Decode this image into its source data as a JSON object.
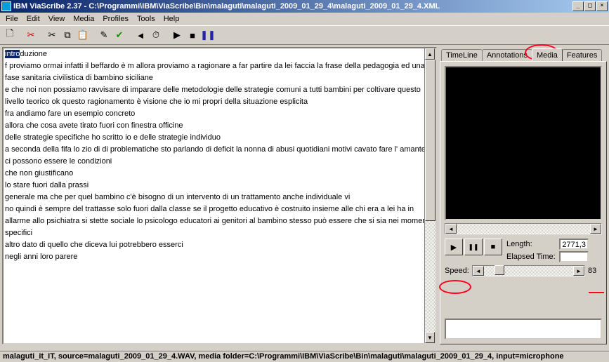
{
  "window": {
    "title": "IBM ViaScribe 2.37 - C:\\Programmi\\IBM\\ViaScribe\\Bin\\malaguti\\malaguti_2009_01_29_4\\malaguti_2009_01_29_4.XML",
    "min": "_",
    "max": "□",
    "close": "×"
  },
  "menu": {
    "file": "File",
    "edit": "Edit",
    "view": "View",
    "media": "Media",
    "profiles": "Profiles",
    "tools": "Tools",
    "help": "Help"
  },
  "transcript": {
    "highlight": "intro",
    "rest_first": "duzione",
    "body": "f proviamo ormai infatti il beffardo è m allora proviamo a ragionare a far partire da lei faccia la frase della pedagogia ed una fase sanitaria civilistica di bambino siciliane\ne che noi non possiamo ravvisare di imparare delle metodologie delle strategie comuni a tutti bambini per coltivare questo livello teorico ok questo ragionamento è visione che io mi propri della situazione esplicita\nfra andiamo fare un esempio concreto\nallora che cosa avete tirato fuori con finestra officine\ndelle strategie specifiche ho scritto io e delle strategie individuo\na seconda della fifa lo zio di di problematiche sto parlando di deficit la nonna di abusi quotidiani motivi cavato fare l' amante\nci possono essere le condizioni\nche non giustificano\nlo stare fuori dalla prassi\ngenerale ma che per quel bambino c'è bisogno di un intervento di un trattamento anche individuale vi\nno quindi è sempre del trattasse solo fuori dalla classe se il progetto educativo è costruito insieme alle chi era a lei ha in allarme allo psichiatra si stette sociale lo psicologo educatori ai genitori al bambino stesso può essere che si sia nei momenti specifici\naltro dato di quello che diceva lui potrebbero esserci\nnegli anni loro parere"
  },
  "tabs": {
    "timeline": "TimeLine",
    "annotations": "Annotations",
    "media": "Media",
    "features": "Features"
  },
  "media": {
    "length_label": "Length:",
    "length_value": "2771,3",
    "elapsed_label": "Elapsed Time:",
    "elapsed_value": "",
    "speed_label": "Speed:",
    "speed_value": "83",
    "play": "▶",
    "pause": "❚❚",
    "stop": "■"
  },
  "status": "malaguti_it_IT, source=malaguti_2009_01_29_4.WAV, media folder=C:\\Programmi\\IBM\\ViaScribe\\Bin\\malaguti\\malaguti_2009_01_29_4, input=microphone"
}
